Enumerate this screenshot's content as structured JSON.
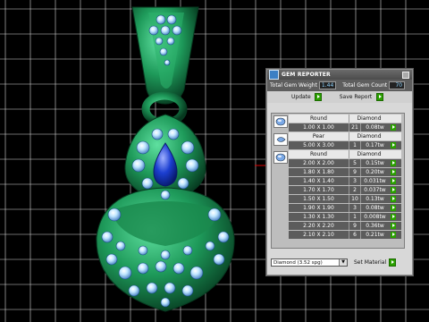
{
  "panel": {
    "title": "GEM REPORTER",
    "total_gem_weight_label": "Total Gem Weight",
    "total_gem_weight_value": "1.44",
    "total_gem_count_label": "Total Gem Count",
    "total_gem_count_value": "70",
    "update_label": "Update",
    "save_report_label": "Save Report",
    "material_value": "Diamond    (3.52 spg)",
    "set_material_label": "Set Material"
  },
  "groups": [
    {
      "shape": "Round",
      "material": "Diamond",
      "icon": "round-gem-icon",
      "rows": [
        {
          "size": "1.00 X 1.00",
          "count": "21",
          "weight": "0.08tw"
        }
      ]
    },
    {
      "shape": "Pear",
      "material": "Diamond",
      "icon": "pear-gem-icon",
      "rows": [
        {
          "size": "5.00 X 3.00",
          "count": "1",
          "weight": "0.17tw"
        }
      ]
    },
    {
      "shape": "Round",
      "material": "Diamond",
      "icon": "round-gem-icon",
      "rows": [
        {
          "size": "2.00 X 2.00",
          "count": "5",
          "weight": "0.15tw"
        },
        {
          "size": "1.80 X 1.80",
          "count": "9",
          "weight": "0.20tw"
        },
        {
          "size": "1.40 X 1.40",
          "count": "3",
          "weight": "0.031tw"
        },
        {
          "size": "1.70 X 1.70",
          "count": "2",
          "weight": "0.037tw"
        },
        {
          "size": "1.50 X 1.50",
          "count": "10",
          "weight": "0.13tw"
        },
        {
          "size": "1.90 X 1.90",
          "count": "3",
          "weight": "0.08tw"
        },
        {
          "size": "1.30 X 1.30",
          "count": "1",
          "weight": "0.008tw"
        },
        {
          "size": "2.20 X 2.20",
          "count": "9",
          "weight": "0.36tw"
        },
        {
          "size": "2.10 X 2.10",
          "count": "6",
          "weight": "0.21tw"
        }
      ]
    }
  ],
  "colors": {
    "metal": "#1e9a5a",
    "metal_dark": "#0c5a32",
    "diamond": "#9fd6ff",
    "sapphire": "#1c3fd1",
    "grid": "#d9d9d9"
  }
}
